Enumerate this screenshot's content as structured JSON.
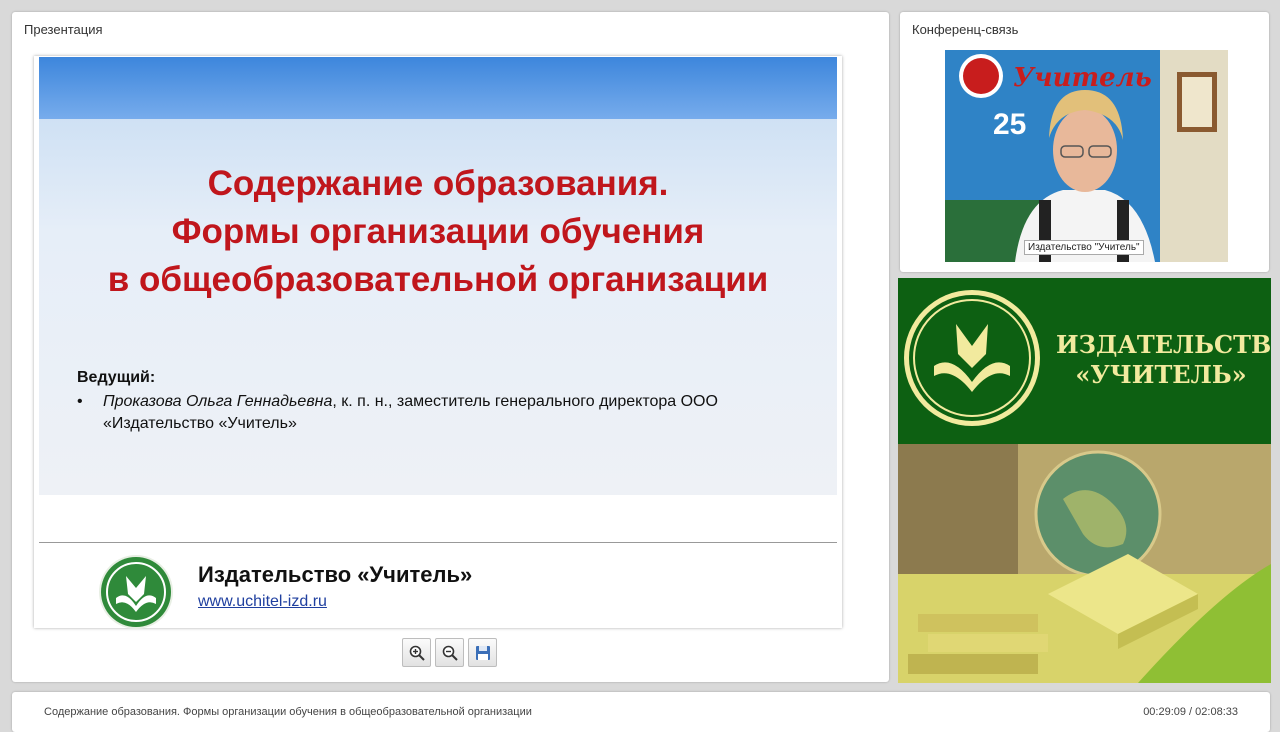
{
  "presentation_panel": {
    "title": "Презентация"
  },
  "slide": {
    "title_lines": [
      "Содержание образования.",
      "Формы организации обучения",
      "в общеобразовательной организации"
    ],
    "presenter_label": "Ведущий:",
    "bullet": "•",
    "presenter_name": "Проказова Ольга Геннадьевна",
    "presenter_details": ", к. п. н., заместитель генерального директора ООО «Издательство «Учитель»",
    "footer_name": "Издательство «Учитель»",
    "footer_url": "www.uchitel-izd.ru"
  },
  "toolbar": {
    "zoom_in_icon": "zoom-in-icon",
    "zoom_out_icon": "zoom-out-icon",
    "save_icon": "save-icon"
  },
  "conference_panel": {
    "title": "Конференц-связь",
    "video_caption": "Издательство \"Учитель\"",
    "video_sign_text": "Учитель",
    "video_sign_number": "25"
  },
  "banner": {
    "line1": "ИЗДАТЕЛЬСТВО",
    "line2": "«УЧИТЕЛЬ»"
  },
  "status_bar": {
    "title": "Содержание образования. Формы организации обучения в общеобразовательной организации",
    "time": "00:29:09 / 02:08:33"
  },
  "colors": {
    "slide_title": "#c0161c",
    "banner_green": "#0d6012",
    "banner_text": "#f2ea9e",
    "link": "#1f3f9f"
  }
}
